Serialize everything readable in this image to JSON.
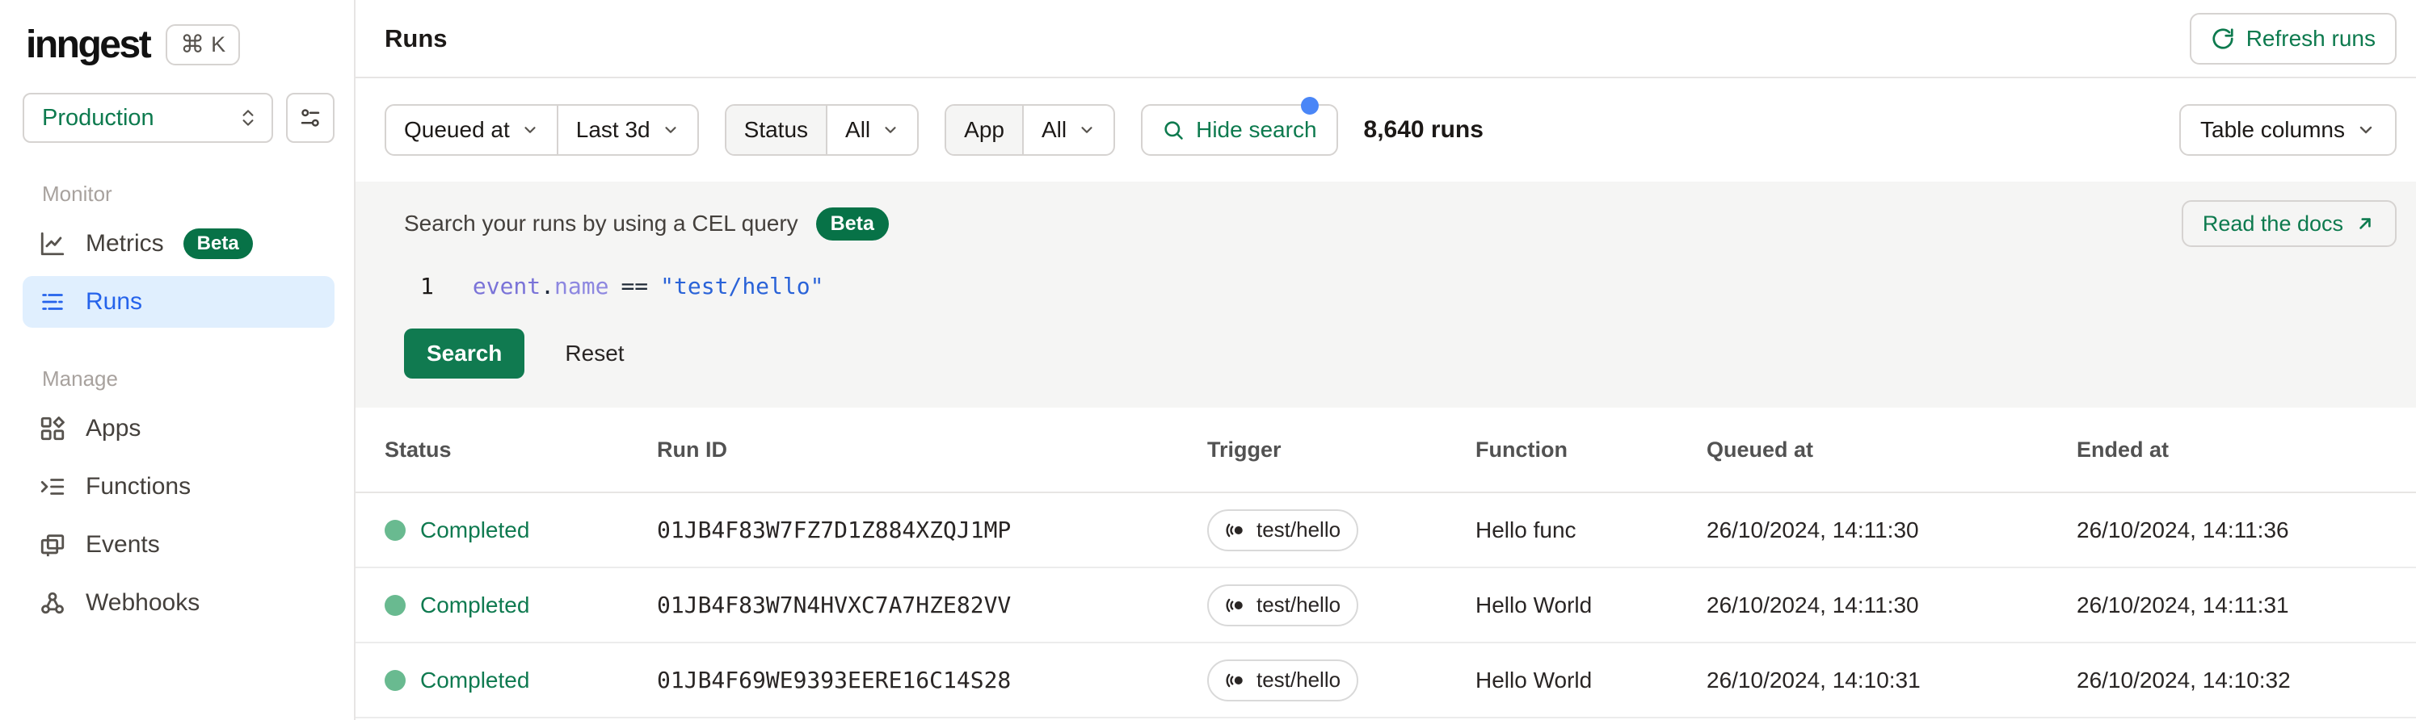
{
  "colors": {
    "brand_green": "#0d7a4e",
    "badge_green": "#077247",
    "primary_button_green": "#107a50",
    "status_dot_green": "#69ba90",
    "active_nav_blue": "#2563eb",
    "active_nav_bg": "#e0effe",
    "notification_dot_blue": "#4a86f7",
    "code_property_purple": "#7a73d8",
    "code_string_blue": "#2a63d8"
  },
  "brand": {
    "logo": "inngest",
    "shortcut_cmd": "⌘",
    "shortcut_key": "K"
  },
  "env": {
    "name": "Production"
  },
  "sidebar": {
    "sections": [
      {
        "label": "Monitor",
        "items": [
          {
            "label": "Metrics",
            "badge": "Beta"
          },
          {
            "label": "Runs"
          }
        ]
      },
      {
        "label": "Manage",
        "items": [
          {
            "label": "Apps"
          },
          {
            "label": "Functions"
          },
          {
            "label": "Events"
          },
          {
            "label": "Webhooks"
          }
        ]
      }
    ]
  },
  "header": {
    "title": "Runs",
    "refresh_label": "Refresh runs"
  },
  "filters": {
    "queued_field": "Queued at",
    "queued_value": "Last 3d",
    "status_label": "Status",
    "status_value": "All",
    "app_label": "App",
    "app_value": "All",
    "search_toggle_label": "Hide search",
    "runs_count": "8,640 runs",
    "table_columns_label": "Table columns"
  },
  "search_panel": {
    "title": "Search your runs by using a CEL query",
    "beta": "Beta",
    "docs_label": "Read the docs",
    "editor": {
      "line_number": "1",
      "tokens": [
        {
          "text": "event"
        },
        {
          "text": "."
        },
        {
          "text": "name"
        },
        {
          "text": "=="
        },
        {
          "text": "\"test/hello\""
        }
      ]
    },
    "search_label": "Search",
    "reset_label": "Reset"
  },
  "table": {
    "columns": [
      "Status",
      "Run ID",
      "Trigger",
      "Function",
      "Queued at",
      "Ended at"
    ],
    "rows": [
      {
        "status": "Completed",
        "run_id": "01JB4F83W7FZ7D1Z884XZQJ1MP",
        "trigger": "test/hello",
        "function": "Hello func",
        "queued_at": "26/10/2024, 14:11:30",
        "ended_at": "26/10/2024, 14:11:36"
      },
      {
        "status": "Completed",
        "run_id": "01JB4F83W7N4HVXC7A7HZE82VV",
        "trigger": "test/hello",
        "function": "Hello World",
        "queued_at": "26/10/2024, 14:11:30",
        "ended_at": "26/10/2024, 14:11:31"
      },
      {
        "status": "Completed",
        "run_id": "01JB4F69WE9393EERE16C14S28",
        "trigger": "test/hello",
        "function": "Hello World",
        "queued_at": "26/10/2024, 14:10:31",
        "ended_at": "26/10/2024, 14:10:32"
      }
    ]
  }
}
